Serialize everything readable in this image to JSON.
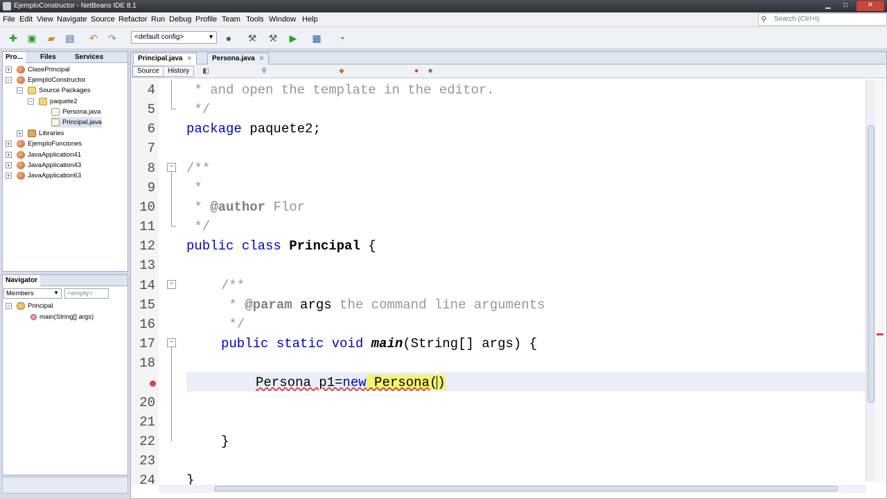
{
  "window": {
    "title": "EjemploConstructor - NetBeans IDE 8.1"
  },
  "menu": [
    "File",
    "Edit",
    "View",
    "Navigate",
    "Source",
    "Refactor",
    "Run",
    "Debug",
    "Profile",
    "Team",
    "Tools",
    "Window",
    "Help"
  ],
  "search": {
    "placeholder": "Search (Ctrl+I)"
  },
  "toolbar": {
    "config": "<default config>"
  },
  "projects_panel": {
    "tabs": [
      "Pro...",
      "Files",
      "Services"
    ],
    "tree": [
      {
        "label": "ClasePrincipal",
        "icon": "project-icon"
      },
      {
        "label": "EjemploConstructor",
        "icon": "project-icon"
      },
      {
        "label": "Source Packages",
        "icon": "package-folder-icon"
      },
      {
        "label": "paquete2",
        "icon": "package-icon"
      },
      {
        "label": "Persona.java",
        "icon": "java-file-icon"
      },
      {
        "label": "Principal.java",
        "icon": "java-file-icon"
      },
      {
        "label": "Libraries",
        "icon": "library-icon"
      },
      {
        "label": "EjemploFunciones",
        "icon": "project-icon"
      },
      {
        "label": "JavaApplication41",
        "icon": "project-icon"
      },
      {
        "label": "JavaApplication43",
        "icon": "project-icon"
      },
      {
        "label": "JavaApplication63",
        "icon": "project-icon"
      }
    ]
  },
  "navigator": {
    "title": "Navigator",
    "filter": "Members",
    "empty": "<empty>",
    "class": "Principal",
    "method": "main(String[] args)"
  },
  "editor": {
    "tabs": [
      "Principal.java",
      "Persona.java"
    ],
    "source_btn": "Source",
    "history_btn": "History",
    "line_numbers": [
      "4",
      "5",
      "6",
      "7",
      "8",
      "9",
      "10",
      "11",
      "12",
      "13",
      "14",
      "15",
      "16",
      "17",
      "18",
      "",
      "20",
      "21",
      "22",
      "23",
      "24"
    ],
    "code": {
      "l4": " * and open the template in the editor.",
      "l5": " */",
      "l6_kw": "package",
      "l6_rest": " paquete2;",
      "l8": "/**",
      "l9": " *",
      "l10_star": " * ",
      "l10_tag": "@author",
      "l10_rest": " Flor",
      "l11": " */",
      "l12_kw": "public class",
      "l12_name": "Principal",
      "l12_rest": " {",
      "l14": "/**",
      "l15_star": " * ",
      "l15_tag": "@param",
      "l15_arg": " args",
      "l15_rest": " the command line arguments",
      "l16": " */",
      "l17_kw": "public static void",
      "l17_name": "main",
      "l17_rest": "(String[] args) {",
      "l19_a": "Persona p1=",
      "l19_new": "new",
      "l19_b": " Persona",
      "l19_paren_open": "(",
      "l19_paren_close": ")",
      "l22": "}",
      "l24": "}"
    }
  }
}
